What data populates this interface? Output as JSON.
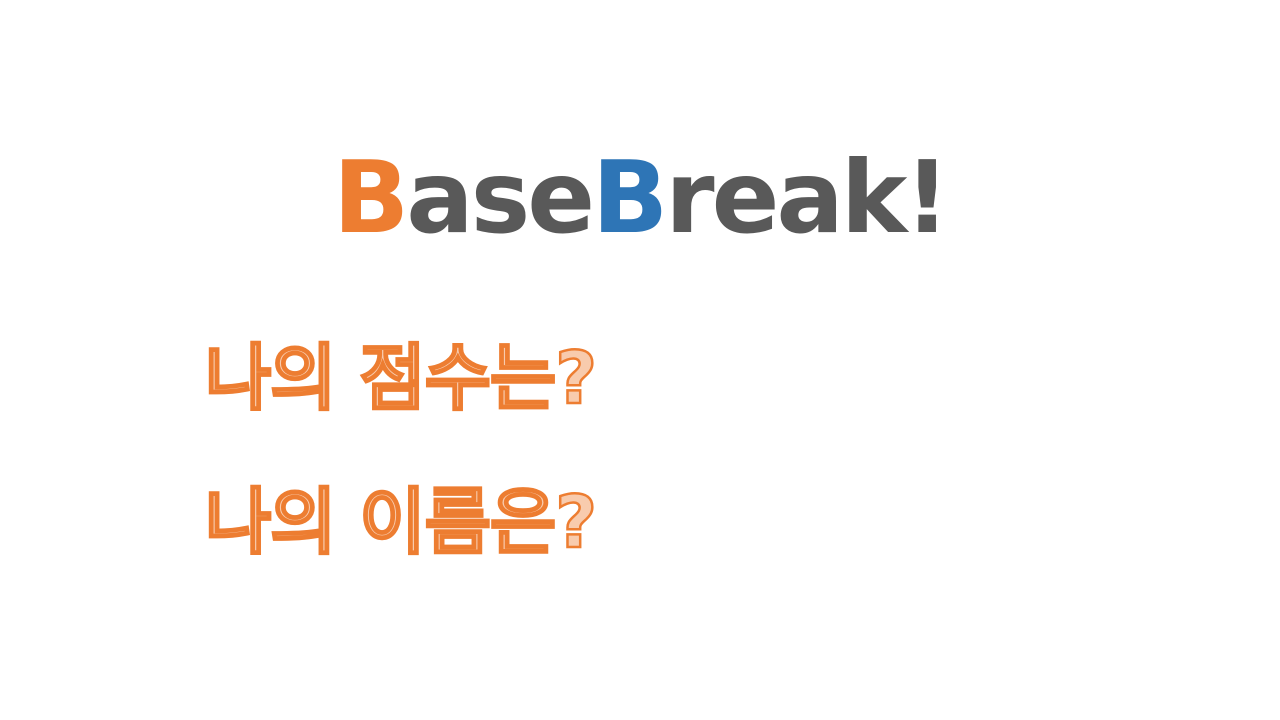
{
  "logo": {
    "part1_initial": "B",
    "part1_rest": "ase",
    "part2_initial": "B",
    "part2_rest": "reak!"
  },
  "prompts": {
    "score": "나의 점수는?",
    "name": "나의 이름은?"
  },
  "colors": {
    "orange": "#ed7d31",
    "blue": "#2e75b6",
    "gray_text": "#595959",
    "prompt_fill": "#f8cbad",
    "background": "#ffffff"
  }
}
